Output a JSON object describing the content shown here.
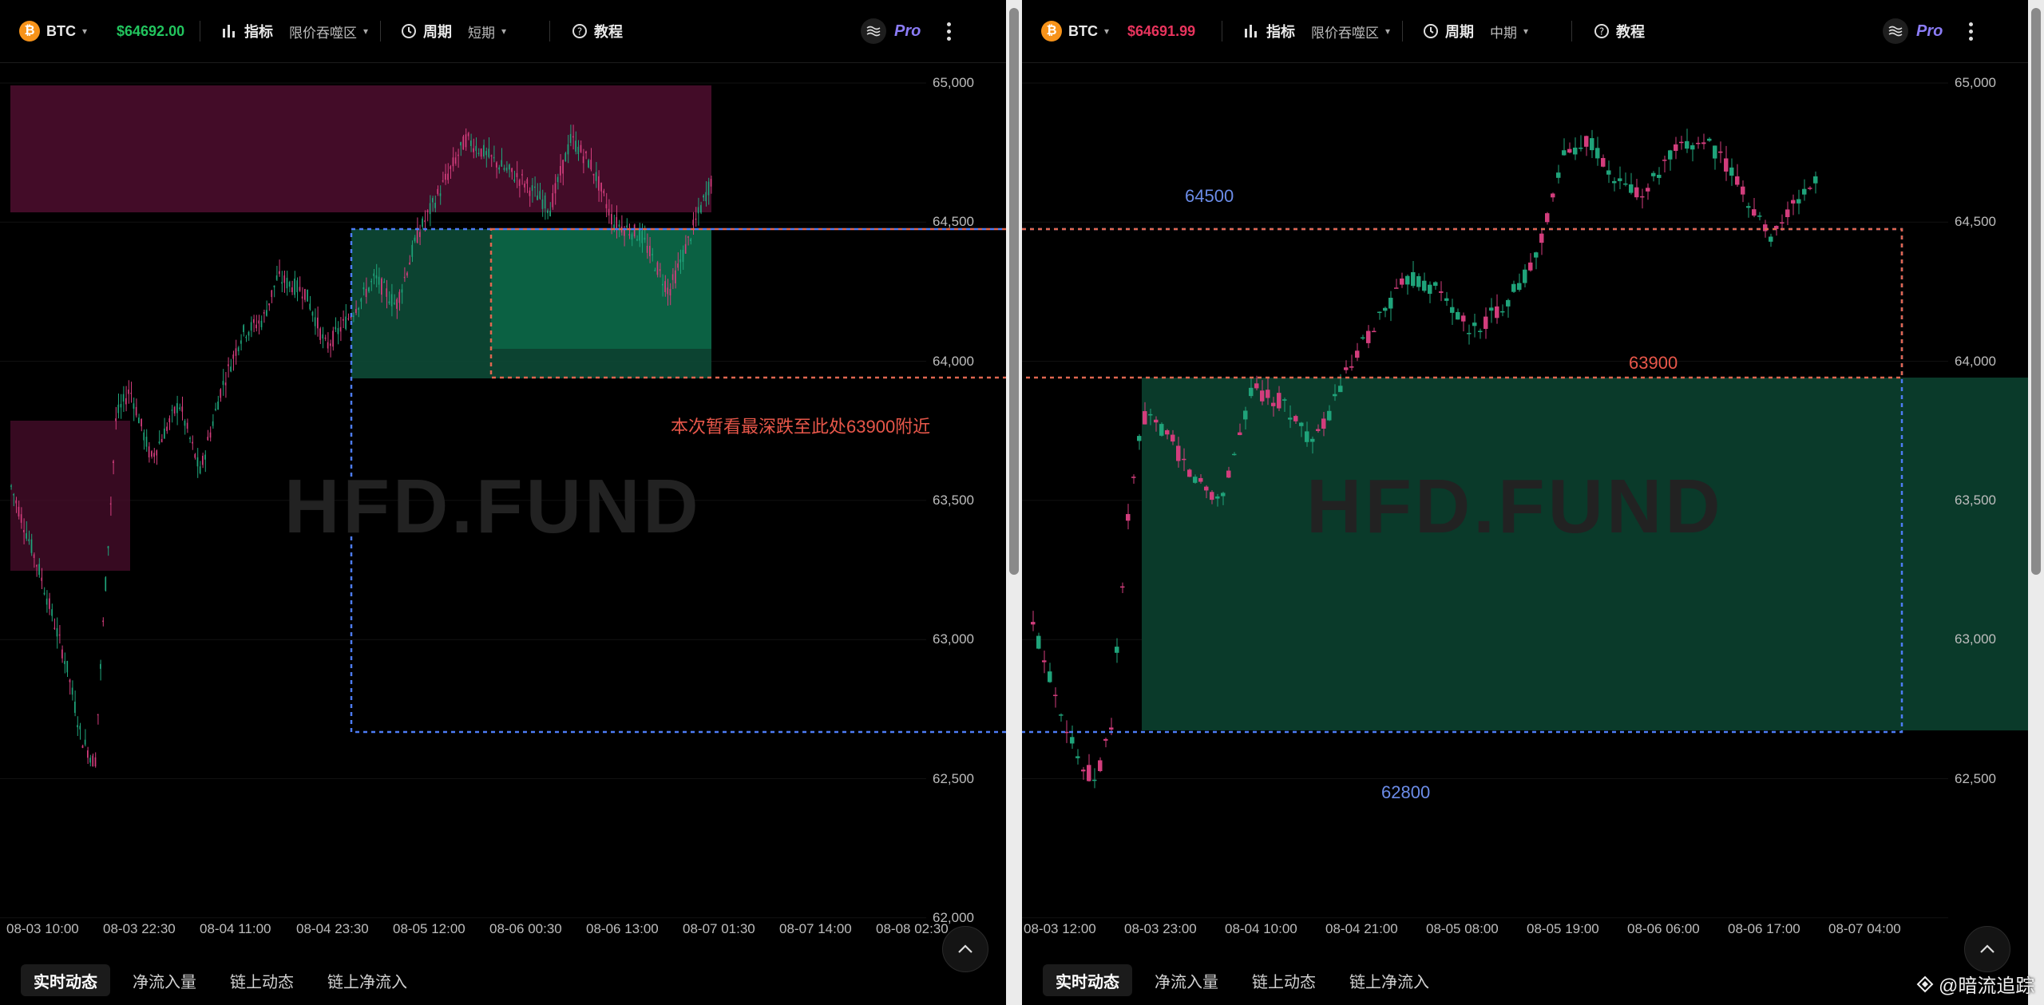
{
  "left": {
    "symbol": "BTC",
    "price": "$64692.00",
    "price_color": "#22c55e",
    "indicator_label": "指标",
    "indicator_value": "限价吞噬区",
    "period_label": "周期",
    "period_value": "短期",
    "tutorial_label": "教程",
    "pro_label": "Pro",
    "watermark": "HFD.FUND",
    "y_ticks": [
      "65,000",
      "64,500",
      "64,000",
      "63,500",
      "63,000",
      "62,500",
      "62,000"
    ],
    "x_ticks": [
      "08-03 10:00",
      "08-03 22:30",
      "08-04 11:00",
      "08-04 23:30",
      "08-05 12:00",
      "08-06 00:30",
      "08-06 13:00",
      "08-07 01:30",
      "08-07 14:00",
      "08-08 02:30"
    ],
    "annotation": "本次暂看最深跌至此处63900附近",
    "annotation_color": "#e8574a",
    "bottom_tabs": [
      "实时动态",
      "净流入量",
      "链上动态",
      "链上净流入"
    ]
  },
  "right": {
    "symbol": "BTC",
    "price": "$64691.99",
    "price_color": "#e8345d",
    "indicator_label": "指标",
    "indicator_value": "限价吞噬区",
    "period_label": "周期",
    "period_value": "中期",
    "tutorial_label": "教程",
    "pro_label": "Pro",
    "watermark": "HFD.FUND",
    "y_ticks": [
      "65,000",
      "64,500",
      "64,000",
      "63,500",
      "63,000",
      "62,500"
    ],
    "x_ticks": [
      "08-03 12:00",
      "08-03 23:00",
      "08-04 10:00",
      "08-04 21:00",
      "08-05 08:00",
      "08-05 19:00",
      "08-06 06:00",
      "08-06 17:00",
      "08-07 04:00"
    ],
    "label_64500": "64500",
    "label_63900": "63900",
    "label_62800": "62800",
    "label_blue_color": "#6b8ce8",
    "label_red_color": "#e8574a",
    "bottom_tabs": [
      "实时动态",
      "净流入量",
      "链上动态",
      "链上净流入"
    ]
  },
  "credit": "@暗流追踪",
  "colors": {
    "up": "#1fa37a",
    "down": "#d23d7c",
    "zone_red": "#4a0d2c",
    "zone_green": "#0b3d2c"
  }
}
